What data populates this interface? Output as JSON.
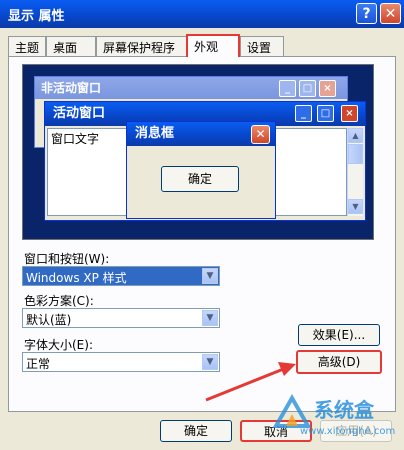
{
  "window": {
    "title": "显示 属性",
    "help_label": "?",
    "close_label": "✕"
  },
  "tabs": [
    "主题",
    "桌面",
    "屏幕保护程序",
    "外观",
    "设置"
  ],
  "preview": {
    "inactive_title": "非活动窗口",
    "active_title": "活动窗口",
    "window_text": "窗口文字",
    "message_title": "消息框",
    "ok_label": "确定"
  },
  "fields": {
    "windows_buttons": {
      "label": "窗口和按钮(W):",
      "value": "Windows XP 样式"
    },
    "color_scheme": {
      "label": "色彩方案(C):",
      "value": "默认(蓝)"
    },
    "font_size": {
      "label": "字体大小(E):",
      "value": "正常"
    }
  },
  "buttons": {
    "effects": "效果(E)...",
    "advanced": "高级(D)",
    "ok": "确定",
    "cancel": "取消",
    "apply": "应用(A)"
  },
  "watermark": {
    "text": "系统盒",
    "url": "www.xitonghe.com"
  },
  "colors": {
    "highlight": "#e53935",
    "accent": "#0a5df2"
  }
}
